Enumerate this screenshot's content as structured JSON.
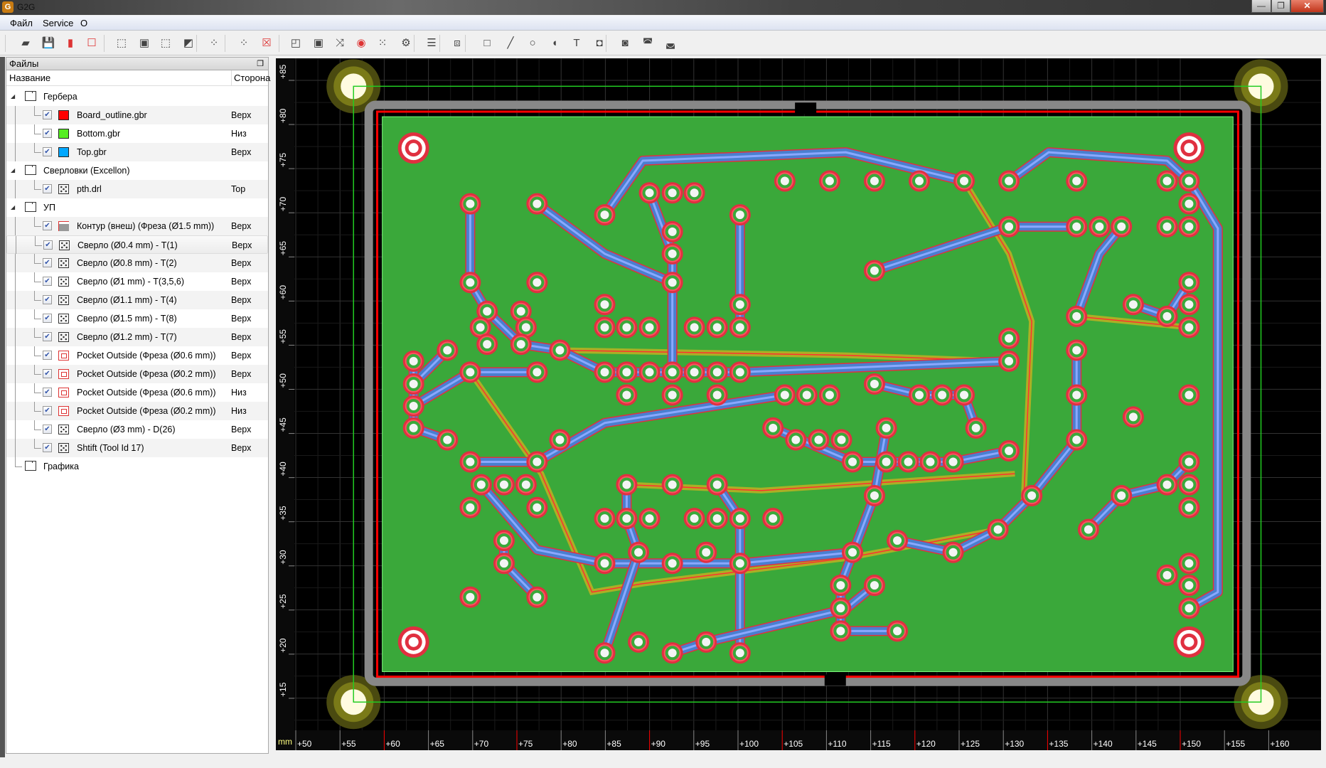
{
  "window": {
    "title": "G2G",
    "logo": "G",
    "minimize": "minimize-icon",
    "restore": "restore-icon",
    "close": "close-icon"
  },
  "menu": [
    "Файл",
    "Service",
    "О"
  ],
  "toolbar": [
    "open-folder-icon",
    "save-icon",
    "export-icon",
    "close-file-icon",
    "fit-all-icon",
    "fit-board-icon",
    "zoom-selection-icon",
    "zoom-out-icon",
    "select-all-icon",
    "deselect-icon",
    "delete-icon",
    "profile-icon",
    "pocket-icon",
    "thermal-icon",
    "drilling-icon",
    "drill-grid-icon",
    "settings-icon",
    "gcode-icon",
    "mirror-icon",
    "rectangle-icon",
    "line-icon",
    "ellipse-icon",
    "arc-icon",
    "text-icon",
    "union-icon",
    "difference-icon",
    "intersection-icon",
    "exclusion-icon"
  ],
  "panel": {
    "title": "Файлы",
    "col_name": "Название",
    "col_side": "Сторона",
    "rows": [
      {
        "type": "folder",
        "label": "Гербера"
      },
      {
        "type": "file",
        "icon": "swatch",
        "color": "#ff0000",
        "label": "Board_outline.gbr",
        "side": "Верх"
      },
      {
        "type": "file",
        "icon": "swatch",
        "color": "#55ee22",
        "label": "Bottom.gbr",
        "side": "Низ"
      },
      {
        "type": "file",
        "icon": "swatch",
        "color": "#00a8ff",
        "label": "Top.gbr",
        "side": "Верх"
      },
      {
        "type": "folder",
        "label": "Сверловки (Excellon)"
      },
      {
        "type": "file",
        "icon": "drill",
        "label": "pth.drl",
        "side": "Top"
      },
      {
        "type": "folder",
        "label": "УП"
      },
      {
        "type": "file",
        "icon": "contour",
        "label": "Контур (внеш) (Фреза (Ø1.5 mm))",
        "side": "Верх"
      },
      {
        "type": "file",
        "icon": "drill",
        "label": "Сверло (Ø0.4 mm) - T(1)",
        "side": "Верх",
        "selected": true
      },
      {
        "type": "file",
        "icon": "drill",
        "label": "Сверло (Ø0.8 mm) - T(2)",
        "side": "Верх"
      },
      {
        "type": "file",
        "icon": "drill",
        "label": "Сверло (Ø1 mm) - T(3,5,6)",
        "side": "Верх"
      },
      {
        "type": "file",
        "icon": "drill",
        "label": "Сверло (Ø1.1 mm) - T(4)",
        "side": "Верх"
      },
      {
        "type": "file",
        "icon": "drill",
        "label": "Сверло (Ø1.5 mm) - T(8)",
        "side": "Верх"
      },
      {
        "type": "file",
        "icon": "drill",
        "label": "Сверло (Ø1.2 mm) - T(7)",
        "side": "Верх"
      },
      {
        "type": "file",
        "icon": "pocket",
        "label": "Pocket Outside (Фреза (Ø0.6 mm))",
        "side": "Верх"
      },
      {
        "type": "file",
        "icon": "pocket",
        "label": "Pocket Outside (Фреза (Ø0.2 mm))",
        "side": "Верх"
      },
      {
        "type": "file",
        "icon": "pocket",
        "label": "Pocket Outside (Фреза (Ø0.6 mm))",
        "side": "Низ"
      },
      {
        "type": "file",
        "icon": "pocket",
        "label": "Pocket Outside (Фреза (Ø0.2 mm))",
        "side": "Низ"
      },
      {
        "type": "file",
        "icon": "drill",
        "label": "Сверло (Ø3 mm) - D(26)",
        "side": "Верх"
      },
      {
        "type": "file",
        "icon": "drill",
        "label": "Shtift (Tool Id 17)",
        "side": "Верх"
      },
      {
        "type": "folder",
        "label": "Графика",
        "last": true
      }
    ]
  },
  "viewer": {
    "unit": "mm",
    "x_ticks": [
      "+50",
      "+55",
      "+60",
      "+65",
      "+70",
      "+75",
      "+80",
      "+85",
      "+90",
      "+95",
      "+100",
      "+105",
      "+110",
      "+115",
      "+120",
      "+125",
      "+130",
      "+135",
      "+140",
      "+145",
      "+150",
      "+155",
      "+160"
    ],
    "y_ticks": [
      "+85",
      "+80",
      "+75",
      "+70",
      "+65",
      "+60",
      "+55",
      "+50",
      "+45",
      "+40",
      "+35",
      "+30",
      "+25",
      "+20",
      "+15"
    ],
    "colors": {
      "background": "#000000",
      "board": "#3aa83a",
      "top_copper": "#4a7fd0",
      "outline": "#ff0000",
      "bottom_copper": "#c8b020",
      "grid": "#2a2a2a"
    }
  }
}
